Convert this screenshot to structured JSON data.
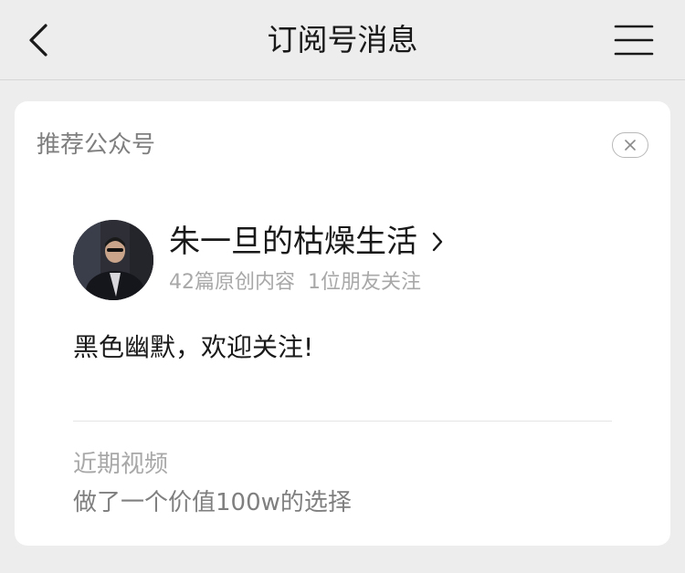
{
  "navbar": {
    "title": "订阅号消息",
    "back_icon": "chevron-left-icon",
    "menu_icon": "hamburger-menu-icon"
  },
  "card": {
    "header": "推荐公众号",
    "close_icon": "close-icon",
    "account": {
      "name": "朱一旦的枯燥生活",
      "original_count": "42篇原创内容",
      "friends_following": "1位朋友关注",
      "description": "黑色幽默，欢迎关注!"
    },
    "recent": {
      "label": "近期视频",
      "item": "做了一个价值100w的选择"
    }
  }
}
